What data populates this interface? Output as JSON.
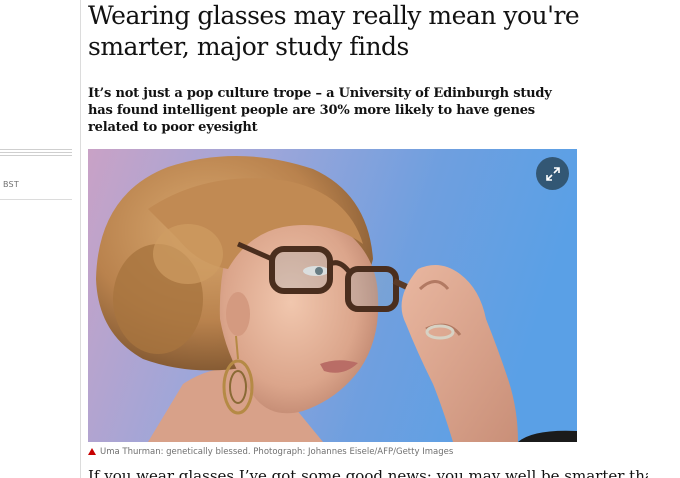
{
  "sidebar": {
    "timezone_label": "BST"
  },
  "article": {
    "headline": "Wearing glasses may really mean you're\nsmarter, major study finds",
    "standfirst": "It’s not just a pop culture trope – a University of Edinburgh study\nhas found intelligent people are 30% more likely to have genes\nrelated to poor eyesight",
    "image": {
      "expand_icon": "expand-arrows-icon",
      "caption": "Uma Thurman: genetically blessed. Photograph: Johannes Eisele/AFP/Getty Images",
      "caption_icon": "red-triangle-icon"
    },
    "body_first_line": "If you wear glasses I’ve got some good news: you may well be smarter than"
  },
  "colors": {
    "caption_triangle": "#c70000",
    "expand_button": "#264254",
    "photo_background": "#7fa7dc"
  }
}
